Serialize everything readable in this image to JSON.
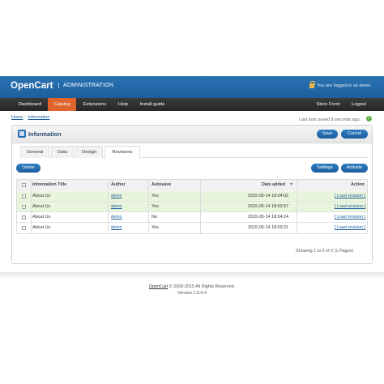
{
  "header": {
    "logo": "OpenCart",
    "subtitle": "ADMINISTRATION",
    "logged_in": "You are logged in as demo"
  },
  "menu": {
    "dashboard": "Dashboard",
    "catalog": "Catalog",
    "extensions": "Extensions",
    "help": "Help",
    "install_guide": "Install guide",
    "store_front": "Store Front",
    "logout": "Logout"
  },
  "breadcrumb": {
    "home": "Home",
    "separator": "::",
    "current": "Information"
  },
  "autosave_status": "Last auto saved 8 seconds ago.",
  "box": {
    "title": "Information",
    "save": "Save",
    "cancel": "Cancel"
  },
  "tabs": [
    "General",
    "Data",
    "Design",
    "Revisions"
  ],
  "actions": {
    "delete": "Delete",
    "settings": "Settings",
    "activate": "Activate"
  },
  "table": {
    "columns": [
      "Information Title",
      "Author",
      "Autosave",
      "Date added",
      "Action"
    ],
    "sort_indicator": "▼",
    "rows": [
      {
        "title": "About Us",
        "author": "demo",
        "autosave": "Yes",
        "date": "2015-05-14 18:04:02",
        "action": "[ Load revision ]"
      },
      {
        "title": "About Us",
        "author": "demo",
        "autosave": "Yes",
        "date": "2015-05-14 18:03:57",
        "action": "[ Load revision ]"
      },
      {
        "title": "About Us",
        "author": "demo",
        "autosave": "No",
        "date": "2015-05-14 18:04:24",
        "action": "[ Load revision ]"
      },
      {
        "title": "About Us",
        "author": "demo",
        "autosave": "Yes",
        "date": "2015-05-14 18:03:21",
        "action": "[ Load revision ]"
      }
    ]
  },
  "pagination": "Showing 1 to 2 of 2 (1 Pages)",
  "footer": {
    "brand": "OpenCart",
    "copyright": "© 2009-2015 All Rights Reserved.",
    "version": "Version 1.5.6.4"
  },
  "colors": {
    "header_blue": "#2a73b4",
    "menu_dark": "#2e2e2e",
    "active_orange": "#e0652a",
    "button_blue": "#1c5f9f",
    "highlight_green": "#e8f5dc"
  }
}
